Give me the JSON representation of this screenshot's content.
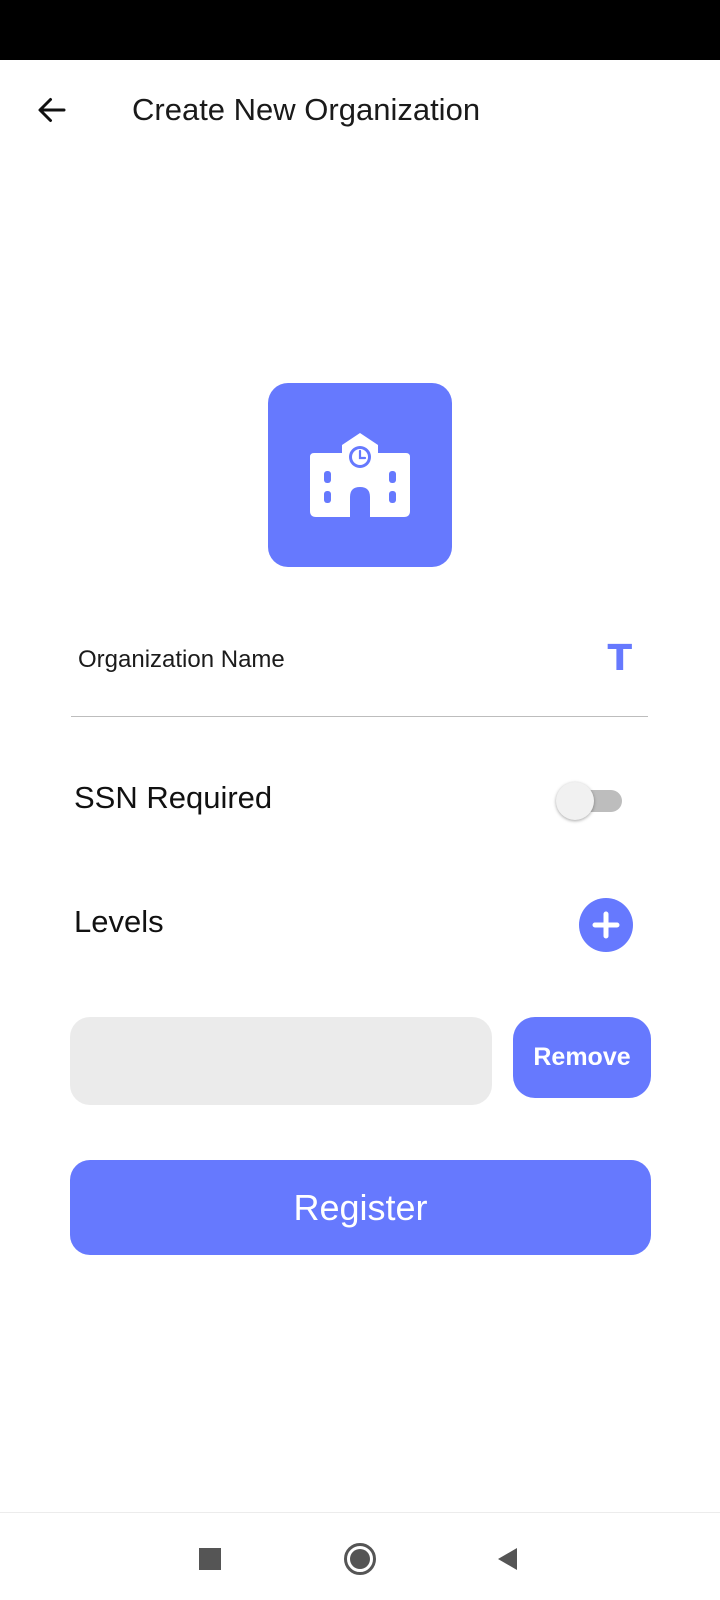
{
  "app_bar": {
    "title": "Create New Organization",
    "back_icon": "arrow-left-icon"
  },
  "logo": {
    "icon": "school-building-icon",
    "background": "#6679fe"
  },
  "form": {
    "name_placeholder": "Organization Name",
    "name_value": "",
    "name_type_icon_glyph": "T",
    "ssn_label": "SSN Required",
    "ssn_required": false,
    "levels_label": "Levels",
    "add_level_icon": "plus-circle-icon",
    "level_inputs": [
      ""
    ],
    "remove_label": "Remove",
    "register_label": "Register"
  },
  "nav": {
    "recents_icon": "square-icon",
    "home_icon": "circle-icon",
    "back_icon": "triangle-back-icon"
  },
  "colors": {
    "accent": "#6679fe",
    "input_fill": "#ebebeb",
    "divider": "#bdbdbd"
  }
}
